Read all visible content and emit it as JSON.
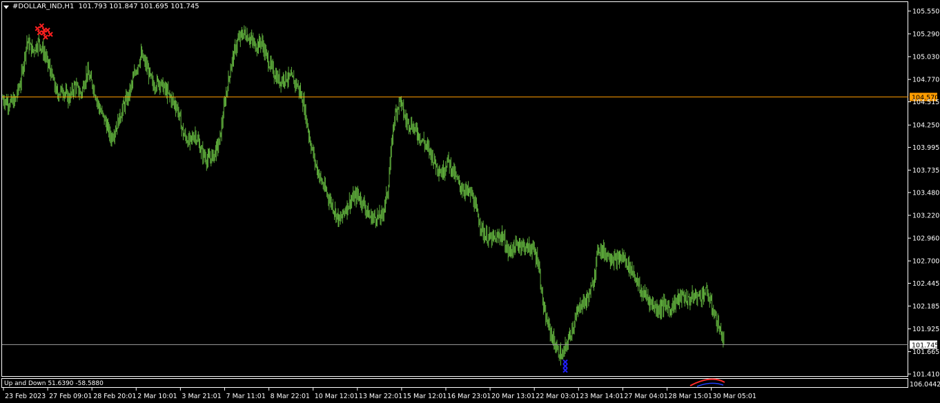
{
  "header": {
    "symbol": "#DOLLAR_IND,H1",
    "ohlc": "101.793 101.847 101.695 101.745"
  },
  "subwindow": {
    "label": "Up and Down 51.6390 -58.5880"
  },
  "colors": {
    "background": "#000000",
    "bars": "#5fae3c",
    "axis": "#ffffff",
    "hline_orange": "#ff9c00",
    "hline_price": "#a0a0a0",
    "sell_signal": "#ff2020",
    "buy_signal": "#2020ff"
  },
  "chart_data": {
    "type": "ohlc",
    "title": "#DOLLAR_IND,H1",
    "ylim": [
      101.3,
      105.65
    ],
    "y_ticks": [
      "105.550",
      "105.290",
      "105.030",
      "104.770",
      "104.515",
      "104.250",
      "103.995",
      "103.735",
      "103.480",
      "103.220",
      "102.960",
      "102.700",
      "102.445",
      "102.185",
      "101.925",
      "101.665",
      "101.410"
    ],
    "x_tick_labels": [
      "23 Feb 2023",
      "27 Feb 09:01",
      "28 Feb 20:01",
      "2 Mar 10:01",
      "3 Mar 21:01",
      "7 Mar 11:01",
      "8 Mar 22:01",
      "10 Mar 12:01",
      "13 Mar 22:01",
      "15 Mar 12:01",
      "16 Mar 23:01",
      "20 Mar 13:01",
      "22 Mar 03:01",
      "23 Mar 14:01",
      "27 Mar 04:01",
      "28 Mar 15:01",
      "30 Mar 05:01"
    ],
    "horizontal_lines": [
      {
        "value": 104.57,
        "label": "104.570",
        "color": "#ff9c00"
      },
      {
        "value": 101.745,
        "label": "101.745",
        "color": "#a0a0a0"
      }
    ],
    "close_path": [
      [
        0,
        104.55
      ],
      [
        2,
        104.5
      ],
      [
        4,
        104.52
      ],
      [
        6,
        104.75
      ],
      [
        8,
        105.2
      ],
      [
        10,
        105.1
      ],
      [
        12,
        105.2
      ],
      [
        14,
        105.05
      ],
      [
        16,
        104.85
      ],
      [
        18,
        104.6
      ],
      [
        20,
        104.65
      ],
      [
        22,
        104.55
      ],
      [
        24,
        104.7
      ],
      [
        26,
        104.6
      ],
      [
        28,
        104.85
      ],
      [
        30,
        104.7
      ],
      [
        32,
        104.45
      ],
      [
        34,
        104.3
      ],
      [
        36,
        104.1
      ],
      [
        38,
        104.25
      ],
      [
        40,
        104.45
      ],
      [
        42,
        104.6
      ],
      [
        44,
        104.85
      ],
      [
        46,
        105.05
      ],
      [
        48,
        104.9
      ],
      [
        50,
        104.7
      ],
      [
        52,
        104.75
      ],
      [
        54,
        104.65
      ],
      [
        56,
        104.55
      ],
      [
        58,
        104.45
      ],
      [
        60,
        104.15
      ],
      [
        62,
        104.05
      ],
      [
        64,
        104.15
      ],
      [
        66,
        103.95
      ],
      [
        68,
        103.85
      ],
      [
        70,
        103.9
      ],
      [
        72,
        104.05
      ],
      [
        74,
        104.55
      ],
      [
        76,
        104.95
      ],
      [
        78,
        105.2
      ],
      [
        80,
        105.3
      ],
      [
        82,
        105.25
      ],
      [
        84,
        105.15
      ],
      [
        86,
        105.2
      ],
      [
        88,
        105.0
      ],
      [
        90,
        104.85
      ],
      [
        92,
        104.75
      ],
      [
        94,
        104.8
      ],
      [
        96,
        104.78
      ],
      [
        98,
        104.7
      ],
      [
        100,
        104.5
      ],
      [
        102,
        104.1
      ],
      [
        104,
        103.8
      ],
      [
        106,
        103.6
      ],
      [
        108,
        103.45
      ],
      [
        110,
        103.3
      ],
      [
        112,
        103.15
      ],
      [
        114,
        103.3
      ],
      [
        116,
        103.4
      ],
      [
        118,
        103.45
      ],
      [
        120,
        103.35
      ],
      [
        122,
        103.2
      ],
      [
        124,
        103.2
      ],
      [
        126,
        103.2
      ],
      [
        128,
        103.5
      ],
      [
        130,
        104.3
      ],
      [
        132,
        104.55
      ],
      [
        134,
        104.3
      ],
      [
        136,
        104.25
      ],
      [
        138,
        104.15
      ],
      [
        140,
        104.05
      ],
      [
        142,
        103.95
      ],
      [
        144,
        103.8
      ],
      [
        146,
        103.7
      ],
      [
        148,
        103.85
      ],
      [
        150,
        103.7
      ],
      [
        152,
        103.55
      ],
      [
        154,
        103.5
      ],
      [
        156,
        103.45
      ],
      [
        158,
        103.2
      ],
      [
        160,
        103.0
      ],
      [
        162,
        102.95
      ],
      [
        164,
        102.95
      ],
      [
        166,
        103.0
      ],
      [
        168,
        102.8
      ],
      [
        170,
        102.85
      ],
      [
        172,
        102.9
      ],
      [
        174,
        102.85
      ],
      [
        176,
        102.85
      ],
      [
        178,
        102.7
      ],
      [
        180,
        102.1
      ],
      [
        182,
        101.9
      ],
      [
        184,
        101.7
      ],
      [
        186,
        101.6
      ],
      [
        188,
        101.8
      ],
      [
        190,
        102.0
      ],
      [
        192,
        102.2
      ],
      [
        194,
        102.25
      ],
      [
        196,
        102.4
      ],
      [
        198,
        102.85
      ],
      [
        200,
        102.8
      ],
      [
        202,
        102.75
      ],
      [
        204,
        102.7
      ],
      [
        206,
        102.75
      ],
      [
        208,
        102.65
      ],
      [
        210,
        102.55
      ],
      [
        212,
        102.35
      ],
      [
        214,
        102.3
      ],
      [
        216,
        102.2
      ],
      [
        218,
        102.15
      ],
      [
        220,
        102.2
      ],
      [
        222,
        102.15
      ],
      [
        224,
        102.25
      ],
      [
        226,
        102.3
      ],
      [
        228,
        102.25
      ],
      [
        230,
        102.3
      ],
      [
        232,
        102.3
      ],
      [
        234,
        102.35
      ],
      [
        236,
        102.15
      ],
      [
        238,
        101.95
      ],
      [
        240,
        101.75
      ]
    ],
    "series_visible_bars": 240,
    "signals": [
      {
        "type": "sell",
        "bar": 12,
        "price": 105.35
      },
      {
        "type": "sell",
        "bar": 14,
        "price": 105.3
      },
      {
        "type": "buy",
        "bar": 187,
        "price": 101.5
      }
    ],
    "subwindow": {
      "name": "Up and Down",
      "values": [
        51.639,
        -58.588
      ],
      "right_label": "106.0442"
    },
    "grid": false
  }
}
